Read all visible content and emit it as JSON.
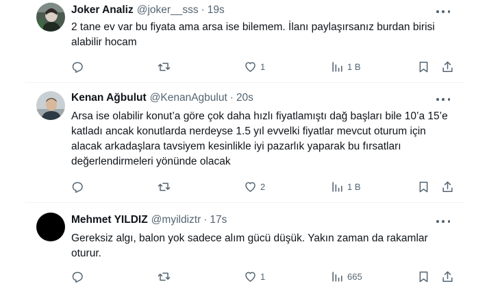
{
  "tweets": [
    {
      "name": "Joker Analiz",
      "handle": "@joker__sss",
      "separator": "·",
      "time": "19s",
      "text": "2 tane ev var bu fiyata ama arsa ise bilemem. İlanı paylaşırsanız burdan birisi alabilir hocam",
      "likes": "1",
      "views": "1 B"
    },
    {
      "name": "Kenan Ağbulut",
      "handle": "@KenanAgbulut",
      "separator": "·",
      "time": "20s",
      "text": "Arsa ise olabilir konut’a göre çok daha hızlı fiyatlamıştı dağ başları bile 10’a 15’e katladı ancak konutlarda nerdeyse 1.5 yıl evvelki fiyatlar mevcut oturum için alacak arkadaşlara tavsiyem kesinlikle iyi pazarlık yaparak bu fırsatları değerlendirmeleri yönünde olacak",
      "likes": "2",
      "views": "1 B"
    },
    {
      "name": "Mehmet YILDIZ",
      "handle": "@myildiztr",
      "separator": "·",
      "time": "17s",
      "text": "Gereksiz algı, balon yok sadece alım gücü düşük. Yakın zaman da rakamlar oturur.",
      "likes": "1",
      "views": "665"
    }
  ],
  "icons": {
    "more": "more-icon",
    "reply": "reply-icon",
    "retweet": "retweet-icon",
    "like": "heart-icon",
    "views": "views-icon",
    "bookmark": "bookmark-icon",
    "share": "share-icon"
  },
  "colors": {
    "text": "#0f1419",
    "muted": "#536471",
    "divider": "#eff3f4",
    "background": "#ffffff"
  }
}
